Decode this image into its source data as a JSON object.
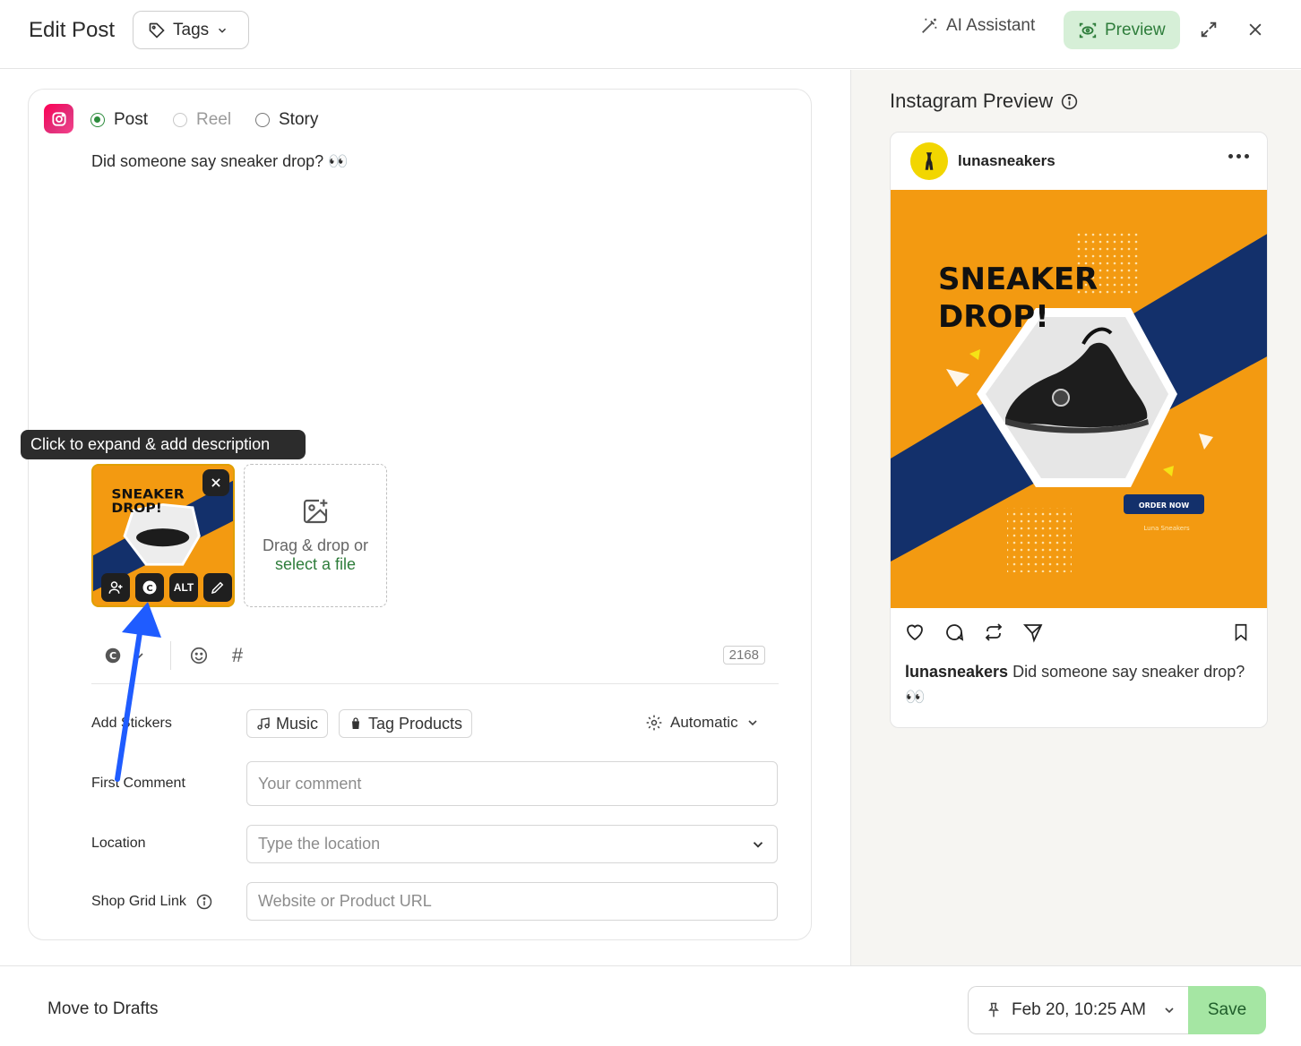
{
  "header": {
    "title": "Edit Post",
    "tags_label": "Tags",
    "ai_label": "AI Assistant",
    "preview_label": "Preview"
  },
  "editor": {
    "post_types": [
      "Post",
      "Reel",
      "Story"
    ],
    "selected_post_type": "Post",
    "caption": "Did someone say sneaker drop? 👀",
    "tooltip": "Click to expand & add description",
    "thumb_tools": [
      "add-person-icon",
      "canva-icon",
      "ALT",
      "edit-icon"
    ],
    "alt_label": "ALT",
    "dropzone_text": "Drag & drop or",
    "dropzone_link": "select a file",
    "char_count": "2168",
    "hashtag": "#"
  },
  "form": {
    "stickers_label": "Add Stickers",
    "music_label": "Music",
    "tag_products_label": "Tag Products",
    "automatic_label": "Automatic",
    "first_comment_label": "First Comment",
    "first_comment_placeholder": "Your comment",
    "location_label": "Location",
    "location_placeholder": "Type the location",
    "shop_label": "Shop Grid Link",
    "shop_placeholder": "Website or Product URL"
  },
  "preview": {
    "title": "Instagram Preview",
    "username": "lunasneakers",
    "image_headline_1": "SNEAKER",
    "image_headline_2": "DROP!",
    "image_button": "ORDER NOW",
    "image_brand": "Luna Sneakers",
    "caption_user": "lunasneakers",
    "caption_text": " Did someone say sneaker drop? 👀"
  },
  "footer": {
    "drafts_label": "Move to Drafts",
    "schedule": "Feb 20, 10:25 AM",
    "save_label": "Save"
  },
  "colors": {
    "accent_green": "#2e7d3b",
    "preview_bg": "#d6efd7",
    "save_bg": "#a5e6a3",
    "instagram": "#e12f7a",
    "poster_orange": "#f39a11",
    "poster_navy": "#13306b",
    "annotation_arrow": "#1f5cff"
  }
}
